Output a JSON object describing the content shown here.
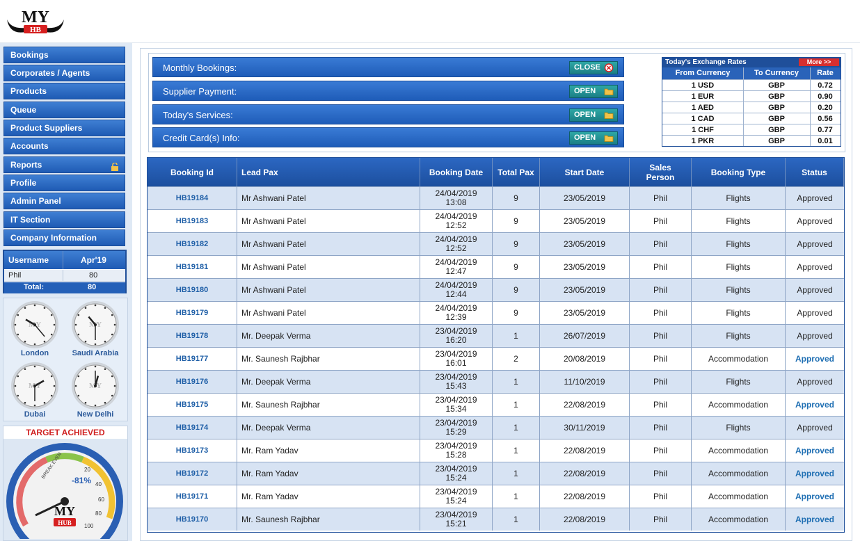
{
  "brand": {
    "logo_text": "MY",
    "logo_sub": "HB"
  },
  "sidebar": {
    "items": [
      {
        "label": "Bookings"
      },
      {
        "label": "Corporates / Agents"
      },
      {
        "label": "Products"
      },
      {
        "label": "Queue"
      },
      {
        "label": "Product Suppliers"
      },
      {
        "label": "Accounts"
      },
      {
        "label": "Reports"
      },
      {
        "label": "Profile"
      },
      {
        "label": "Admin Panel"
      },
      {
        "label": "IT Section"
      },
      {
        "label": "Company Information"
      }
    ],
    "user_table": {
      "col_user": "Username",
      "col_month": "Apr'19",
      "user": "Phil",
      "value": "80",
      "total_label": "Total:",
      "total_value": "80"
    },
    "clocks": [
      {
        "label": "London"
      },
      {
        "label": "Saudi Arabia"
      },
      {
        "label": "Dubai"
      },
      {
        "label": "New Delhi"
      }
    ],
    "target": {
      "title": "TARGET ACHIEVED",
      "gauge_text": "-81%",
      "brand_text": "MY",
      "brand_sub": "HUB",
      "arc_text": "BREAK EVEN",
      "ticks": [
        "20",
        "40",
        "60",
        "80",
        "100"
      ]
    }
  },
  "panels": [
    {
      "label": "Monthly Bookings:",
      "button": "CLOSE",
      "icon": "close-circle-icon"
    },
    {
      "label": "Supplier Payment:",
      "button": "OPEN",
      "icon": "folder-icon"
    },
    {
      "label": "Today's Services:",
      "button": "OPEN",
      "icon": "folder-icon"
    },
    {
      "label": "Credit Card(s) Info:",
      "button": "OPEN",
      "icon": "folder-icon"
    }
  ],
  "exchange": {
    "title": "Today's Exchange Rates",
    "more": "More >>",
    "headers": [
      "From Currency",
      "To Currency",
      "Rate"
    ],
    "rows": [
      [
        "1 USD",
        "GBP",
        "0.72"
      ],
      [
        "1 EUR",
        "GBP",
        "0.90"
      ],
      [
        "1 AED",
        "GBP",
        "0.20"
      ],
      [
        "1 CAD",
        "GBP",
        "0.56"
      ],
      [
        "1 CHF",
        "GBP",
        "0.77"
      ],
      [
        "1 PKR",
        "GBP",
        "0.01"
      ]
    ]
  },
  "bookings": {
    "headers": [
      "Booking Id",
      "Lead Pax",
      "Booking Date",
      "Total Pax",
      "Start Date",
      "Sales Person",
      "Booking Type",
      "Status"
    ],
    "rows": [
      {
        "id": "HB19184",
        "pax": "Mr Ashwani Patel",
        "date": "24/04/2019",
        "time": "13:08",
        "total": "9",
        "start": "23/05/2019",
        "sales": "Phil",
        "type": "Flights",
        "status": "Approved"
      },
      {
        "id": "HB19183",
        "pax": "Mr Ashwani Patel",
        "date": "24/04/2019",
        "time": "12:52",
        "total": "9",
        "start": "23/05/2019",
        "sales": "Phil",
        "type": "Flights",
        "status": "Approved"
      },
      {
        "id": "HB19182",
        "pax": "Mr Ashwani Patel",
        "date": "24/04/2019",
        "time": "12:52",
        "total": "9",
        "start": "23/05/2019",
        "sales": "Phil",
        "type": "Flights",
        "status": "Approved"
      },
      {
        "id": "HB19181",
        "pax": "Mr Ashwani Patel",
        "date": "24/04/2019",
        "time": "12:47",
        "total": "9",
        "start": "23/05/2019",
        "sales": "Phil",
        "type": "Flights",
        "status": "Approved"
      },
      {
        "id": "HB19180",
        "pax": "Mr Ashwani Patel",
        "date": "24/04/2019",
        "time": "12:44",
        "total": "9",
        "start": "23/05/2019",
        "sales": "Phil",
        "type": "Flights",
        "status": "Approved"
      },
      {
        "id": "HB19179",
        "pax": "Mr Ashwani Patel",
        "date": "24/04/2019",
        "time": "12:39",
        "total": "9",
        "start": "23/05/2019",
        "sales": "Phil",
        "type": "Flights",
        "status": "Approved"
      },
      {
        "id": "HB19178",
        "pax": "Mr. Deepak Verma",
        "date": "23/04/2019",
        "time": "16:20",
        "total": "1",
        "start": "26/07/2019",
        "sales": "Phil",
        "type": "Flights",
        "status": "Approved"
      },
      {
        "id": "HB19177",
        "pax": "Mr. Saunesh Rajbhar",
        "date": "23/04/2019",
        "time": "16:01",
        "total": "2",
        "start": "20/08/2019",
        "sales": "Phil",
        "type": "Accommodation",
        "status": "Approved",
        "link": true
      },
      {
        "id": "HB19176",
        "pax": "Mr. Deepak Verma",
        "date": "23/04/2019",
        "time": "15:43",
        "total": "1",
        "start": "11/10/2019",
        "sales": "Phil",
        "type": "Flights",
        "status": "Approved"
      },
      {
        "id": "HB19175",
        "pax": "Mr. Saunesh Rajbhar",
        "date": "23/04/2019",
        "time": "15:34",
        "total": "1",
        "start": "22/08/2019",
        "sales": "Phil",
        "type": "Accommodation",
        "status": "Approved",
        "link": true
      },
      {
        "id": "HB19174",
        "pax": "Mr. Deepak Verma",
        "date": "23/04/2019",
        "time": "15:29",
        "total": "1",
        "start": "30/11/2019",
        "sales": "Phil",
        "type": "Flights",
        "status": "Approved"
      },
      {
        "id": "HB19173",
        "pax": "Mr. Ram Yadav",
        "date": "23/04/2019",
        "time": "15:28",
        "total": "1",
        "start": "22/08/2019",
        "sales": "Phil",
        "type": "Accommodation",
        "status": "Approved",
        "link": true
      },
      {
        "id": "HB19172",
        "pax": "Mr. Ram Yadav",
        "date": "23/04/2019",
        "time": "15:24",
        "total": "1",
        "start": "22/08/2019",
        "sales": "Phil",
        "type": "Accommodation",
        "status": "Approved",
        "link": true
      },
      {
        "id": "HB19171",
        "pax": "Mr. Ram Yadav",
        "date": "23/04/2019",
        "time": "15:24",
        "total": "1",
        "start": "22/08/2019",
        "sales": "Phil",
        "type": "Accommodation",
        "status": "Approved",
        "link": true
      },
      {
        "id": "HB19170",
        "pax": "Mr. Saunesh Rajbhar",
        "date": "23/04/2019",
        "time": "15:21",
        "total": "1",
        "start": "22/08/2019",
        "sales": "Phil",
        "type": "Accommodation",
        "status": "Approved",
        "link": true
      }
    ]
  }
}
